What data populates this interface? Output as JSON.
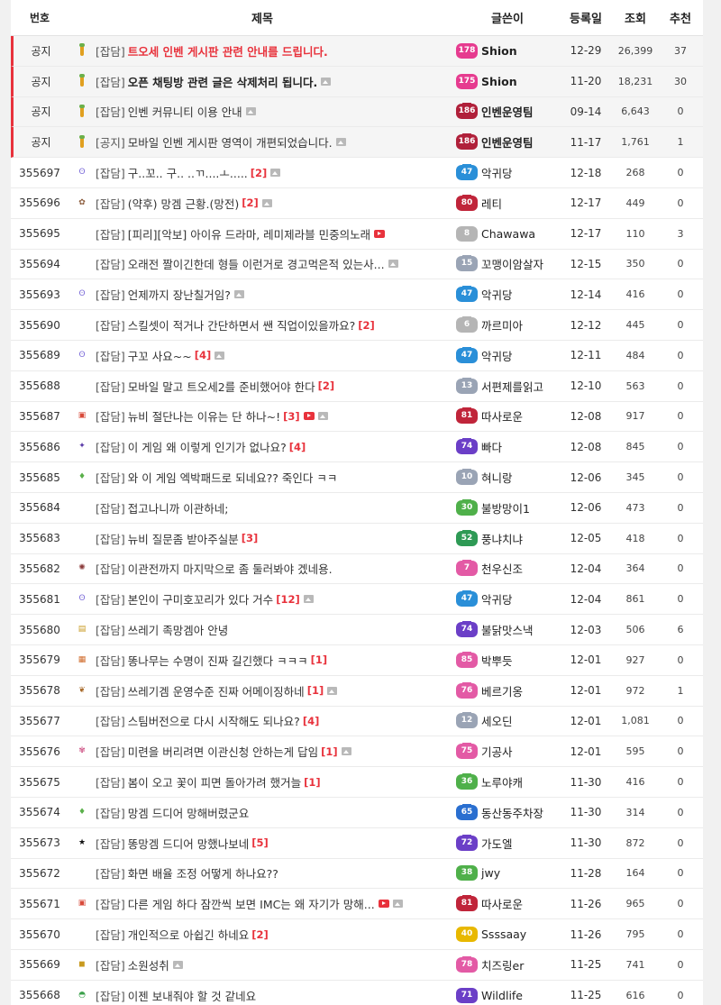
{
  "header": {
    "num": "번호",
    "title": "제목",
    "writer": "글쓴이",
    "date": "등록일",
    "views": "조회",
    "recommend": "추천"
  },
  "colors": {
    "accent_red": "#e8323c",
    "notice_bg": "#f5f5f5"
  },
  "rows": [
    {
      "num": "공지",
      "notice": true,
      "icon": "notice-pin-icon",
      "cat": "[잡담]",
      "title": "트오세 인벤 게시판 관련 안내를 드립니다.",
      "style": "red",
      "comments": "",
      "img": false,
      "video": false,
      "level": "178",
      "lvcolor": "#e63b8f",
      "writer": "Shion",
      "wbold": true,
      "date": "12-29",
      "views": "26,399",
      "rec": "37"
    },
    {
      "num": "공지",
      "notice": true,
      "icon": "notice-pin-icon",
      "cat": "[잡담]",
      "title": "오픈 채팅방 관련 글은 삭제처리 됩니다.",
      "style": "bold",
      "comments": "",
      "img": true,
      "video": false,
      "level": "175",
      "lvcolor": "#e63b8f",
      "writer": "Shion",
      "wbold": true,
      "date": "11-20",
      "views": "18,231",
      "rec": "30"
    },
    {
      "num": "공지",
      "notice": true,
      "icon": "notice-pin-icon",
      "cat": "[잡담]",
      "title": "인벤 커뮤니티 이용 안내",
      "style": "",
      "comments": "",
      "img": true,
      "video": false,
      "level": "186",
      "lvcolor": "#b0203a",
      "writer": "인벤운영팀",
      "wbold": true,
      "date": "09-14",
      "views": "6,643",
      "rec": "0"
    },
    {
      "num": "공지",
      "notice": true,
      "icon": "notice-pin-icon",
      "cat": "[공지]",
      "title": "모바일 인벤 게시판 영역이 개편되었습니다.",
      "style": "",
      "comments": "",
      "img": true,
      "video": false,
      "level": "186",
      "lvcolor": "#b0203a",
      "writer": "인벤운영팀",
      "wbold": true,
      "date": "11-17",
      "views": "1,761",
      "rec": "1"
    },
    {
      "num": "355697",
      "icon": "bear-icon",
      "cat": "[잡담]",
      "title": "구..꼬.. 구.. ..ㄲ....ㅗ.....",
      "style": "",
      "comments": "[2]",
      "img": true,
      "video": false,
      "level": "47",
      "lvcolor": "#2a8fd8",
      "writer": "악귀당",
      "date": "12-18",
      "views": "268",
      "rec": "0"
    },
    {
      "num": "355696",
      "icon": "cookie-icon",
      "cat": "[잡담]",
      "title": "(약후) 망겜 근황.(망전)",
      "style": "",
      "comments": "[2]",
      "img": true,
      "video": false,
      "level": "80",
      "lvcolor": "#c0253a",
      "writer": "레티",
      "date": "12-17",
      "views": "449",
      "rec": "0"
    },
    {
      "num": "355695",
      "icon": "",
      "cat": "[잡담]",
      "title": "[피리][악보] 아이유 드라마, 레미제라블 민중의노래",
      "style": "",
      "comments": "",
      "img": false,
      "video": true,
      "level": "8",
      "lvcolor": "#b5b5b5",
      "writer": "Chawawa",
      "date": "12-17",
      "views": "110",
      "rec": "3"
    },
    {
      "num": "355694",
      "icon": "",
      "cat": "[잡담]",
      "title": "오래전 짤이긴한데 형들 이런거로 경고먹은적 있는사...",
      "style": "",
      "comments": "",
      "img": true,
      "video": false,
      "level": "15",
      "lvcolor": "#9aa4b5",
      "writer": "꼬맹이암살자",
      "date": "12-15",
      "views": "350",
      "rec": "0"
    },
    {
      "num": "355693",
      "icon": "bear-icon",
      "cat": "[잡담]",
      "title": "언제까지 장난칠거임?",
      "style": "",
      "comments": "",
      "img": true,
      "video": false,
      "level": "47",
      "lvcolor": "#2a8fd8",
      "writer": "악귀당",
      "date": "12-14",
      "views": "416",
      "rec": "0"
    },
    {
      "num": "355690",
      "icon": "",
      "cat": "[잡담]",
      "title": "스킬셋이 적거나 간단하면서 쌘 직업이있을까요?",
      "style": "",
      "comments": "[2]",
      "img": false,
      "video": false,
      "level": "6",
      "lvcolor": "#b5b5b5",
      "writer": "까르미아",
      "date": "12-12",
      "views": "445",
      "rec": "0"
    },
    {
      "num": "355689",
      "icon": "bear-icon",
      "cat": "[잡담]",
      "title": "구꼬 사요~~",
      "style": "",
      "comments": "[4]",
      "img": true,
      "video": false,
      "level": "47",
      "lvcolor": "#2a8fd8",
      "writer": "악귀당",
      "date": "12-11",
      "views": "484",
      "rec": "0"
    },
    {
      "num": "355688",
      "icon": "",
      "cat": "[잡담]",
      "title": "모바일 말고 트오세2를 준비했어야 한다",
      "style": "",
      "comments": "[2]",
      "img": false,
      "video": false,
      "level": "13",
      "lvcolor": "#9aa4b5",
      "writer": "서편제를읽고",
      "date": "12-10",
      "views": "563",
      "rec": "0"
    },
    {
      "num": "355687",
      "icon": "gift-icon",
      "cat": "[잡담]",
      "title": "뉴비 절단나는 이유는 단 하나~!",
      "style": "",
      "comments": "[3]",
      "img": true,
      "video": true,
      "level": "81",
      "lvcolor": "#c0253a",
      "writer": "따사로운",
      "date": "12-08",
      "views": "917",
      "rec": "0"
    },
    {
      "num": "355686",
      "icon": "mage-icon",
      "cat": "[잡담]",
      "title": "이 게임 왜 이렇게 인기가 없나요?",
      "style": "",
      "comments": "[4]",
      "img": false,
      "video": false,
      "level": "74",
      "lvcolor": "#6b3fc7",
      "writer": "빠다",
      "date": "12-08",
      "views": "845",
      "rec": "0"
    },
    {
      "num": "355685",
      "icon": "shield-icon",
      "cat": "[잡담]",
      "title": "와 이 게임 엑박패드로 되네요?? 죽인다 ㅋㅋ",
      "style": "",
      "comments": "",
      "img": false,
      "video": false,
      "level": "10",
      "lvcolor": "#9aa4b5",
      "writer": "혀니랑",
      "date": "12-06",
      "views": "345",
      "rec": "0"
    },
    {
      "num": "355684",
      "icon": "",
      "cat": "[잡담]",
      "title": "접고나니까 이관하네;",
      "style": "",
      "comments": "",
      "img": false,
      "video": false,
      "level": "30",
      "lvcolor": "#4fb04a",
      "writer": "불방망이1",
      "date": "12-06",
      "views": "473",
      "rec": "0"
    },
    {
      "num": "355683",
      "icon": "",
      "cat": "[잡담]",
      "title": "뉴비 질문좀 받아주실분",
      "style": "",
      "comments": "[3]",
      "img": false,
      "video": false,
      "level": "52",
      "lvcolor": "#2e9a55",
      "writer": "풍냐치냐",
      "date": "12-05",
      "views": "418",
      "rec": "0"
    },
    {
      "num": "355682",
      "icon": "gear-icon",
      "cat": "[잡담]",
      "title": "이관전까지 마지막으로 좀 둘러봐야 겠네용.",
      "style": "",
      "comments": "",
      "img": false,
      "video": false,
      "level": "7",
      "lvcolor": "#e35aa5",
      "writer": "천우신조",
      "date": "12-04",
      "views": "364",
      "rec": "0"
    },
    {
      "num": "355681",
      "icon": "bear-icon",
      "cat": "[잡담]",
      "title": "본인이 구미호꼬리가 있다 거수",
      "style": "",
      "comments": "[12]",
      "img": true,
      "video": false,
      "level": "47",
      "lvcolor": "#2a8fd8",
      "writer": "악귀당",
      "date": "12-04",
      "views": "861",
      "rec": "0"
    },
    {
      "num": "355680",
      "icon": "box-icon",
      "cat": "[잡담]",
      "title": "쓰레기 족망겜아 안녕",
      "style": "",
      "comments": "",
      "img": false,
      "video": false,
      "level": "74",
      "lvcolor": "#6b3fc7",
      "writer": "불닭맛스낵",
      "date": "12-03",
      "views": "506",
      "rec": "6"
    },
    {
      "num": "355679",
      "icon": "tree-icon",
      "cat": "[잡담]",
      "title": "똥나무는 수명이 진짜 길긴했다 ㅋㅋㅋ",
      "style": "",
      "comments": "[1]",
      "img": false,
      "video": false,
      "level": "85",
      "lvcolor": "#e35aa5",
      "writer": "박뿌듯",
      "date": "12-01",
      "views": "927",
      "rec": "0"
    },
    {
      "num": "355678",
      "icon": "leaf-icon",
      "cat": "[잡담]",
      "title": "쓰레기겜 운영수준 진짜 어메이징하네",
      "style": "",
      "comments": "[1]",
      "img": true,
      "video": false,
      "level": "76",
      "lvcolor": "#e35aa5",
      "writer": "베르기옹",
      "date": "12-01",
      "views": "972",
      "rec": "1"
    },
    {
      "num": "355677",
      "icon": "",
      "cat": "[잡담]",
      "title": "스팀버전으로 다시 시작해도 되나요?",
      "style": "",
      "comments": "[4]",
      "img": false,
      "video": false,
      "level": "12",
      "lvcolor": "#9aa4b5",
      "writer": "세오딘",
      "date": "12-01",
      "views": "1,081",
      "rec": "0"
    },
    {
      "num": "355676",
      "icon": "flower-icon",
      "cat": "[잡담]",
      "title": "미련을 버리려면 이관신청 안하는게 답임",
      "style": "",
      "comments": "[1]",
      "img": true,
      "video": false,
      "level": "75",
      "lvcolor": "#e35aa5",
      "writer": "기공사",
      "date": "12-01",
      "views": "595",
      "rec": "0"
    },
    {
      "num": "355675",
      "icon": "",
      "cat": "[잡담]",
      "title": "봄이 오고 꽃이 피면 돌아가려 했거늘",
      "style": "",
      "comments": "[1]",
      "img": false,
      "video": false,
      "level": "36",
      "lvcolor": "#4fb04a",
      "writer": "노루야캐",
      "date": "11-30",
      "views": "416",
      "rec": "0"
    },
    {
      "num": "355674",
      "icon": "shield-icon",
      "cat": "[잡담]",
      "title": "망겜 드디어 망해버렸군요",
      "style": "",
      "comments": "",
      "img": false,
      "video": false,
      "level": "65",
      "lvcolor": "#2a6fd0",
      "writer": "동산동주차장",
      "date": "11-30",
      "views": "314",
      "rec": "0"
    },
    {
      "num": "355673",
      "icon": "star-icon",
      "cat": "[잡담]",
      "title": "똥망겜 드디어 망했나보네",
      "style": "",
      "comments": "[5]",
      "img": false,
      "video": false,
      "level": "72",
      "lvcolor": "#6b3fc7",
      "writer": "가도엘",
      "date": "11-30",
      "views": "872",
      "rec": "0"
    },
    {
      "num": "355672",
      "icon": "",
      "cat": "[잡담]",
      "title": "화면 배율 조정 어떻게 하나요??",
      "style": "",
      "comments": "",
      "img": false,
      "video": false,
      "level": "38",
      "lvcolor": "#4fb04a",
      "writer": "jwy",
      "date": "11-28",
      "views": "164",
      "rec": "0"
    },
    {
      "num": "355671",
      "icon": "gift-icon",
      "cat": "[잡담]",
      "title": "다른 게임 하다 잠깐씩 보면 IMC는 왜 자기가 망해...",
      "style": "",
      "comments": "",
      "img": true,
      "video": true,
      "level": "81",
      "lvcolor": "#c0253a",
      "writer": "따사로운",
      "date": "11-26",
      "views": "965",
      "rec": "0"
    },
    {
      "num": "355670",
      "icon": "",
      "cat": "[잡담]",
      "title": "개인적으로 아쉽긴 하네요",
      "style": "",
      "comments": "[2]",
      "img": false,
      "video": false,
      "level": "40",
      "lvcolor": "#e8b800",
      "writer": "Ssssaay",
      "date": "11-26",
      "views": "795",
      "rec": "0"
    },
    {
      "num": "355669",
      "icon": "badge-icon",
      "cat": "[잡담]",
      "title": "소원성취",
      "style": "",
      "comments": "",
      "img": true,
      "video": false,
      "level": "78",
      "lvcolor": "#e35aa5",
      "writer": "치즈링er",
      "date": "11-25",
      "views": "741",
      "rec": "0"
    },
    {
      "num": "355668",
      "icon": "watermelon-icon",
      "cat": "[잡담]",
      "title": "이젠 보내줘야 할 것 같네요",
      "style": "",
      "comments": "",
      "img": false,
      "video": false,
      "level": "71",
      "lvcolor": "#6b3fc7",
      "writer": "Wildlife",
      "date": "11-25",
      "views": "616",
      "rec": "0"
    }
  ]
}
